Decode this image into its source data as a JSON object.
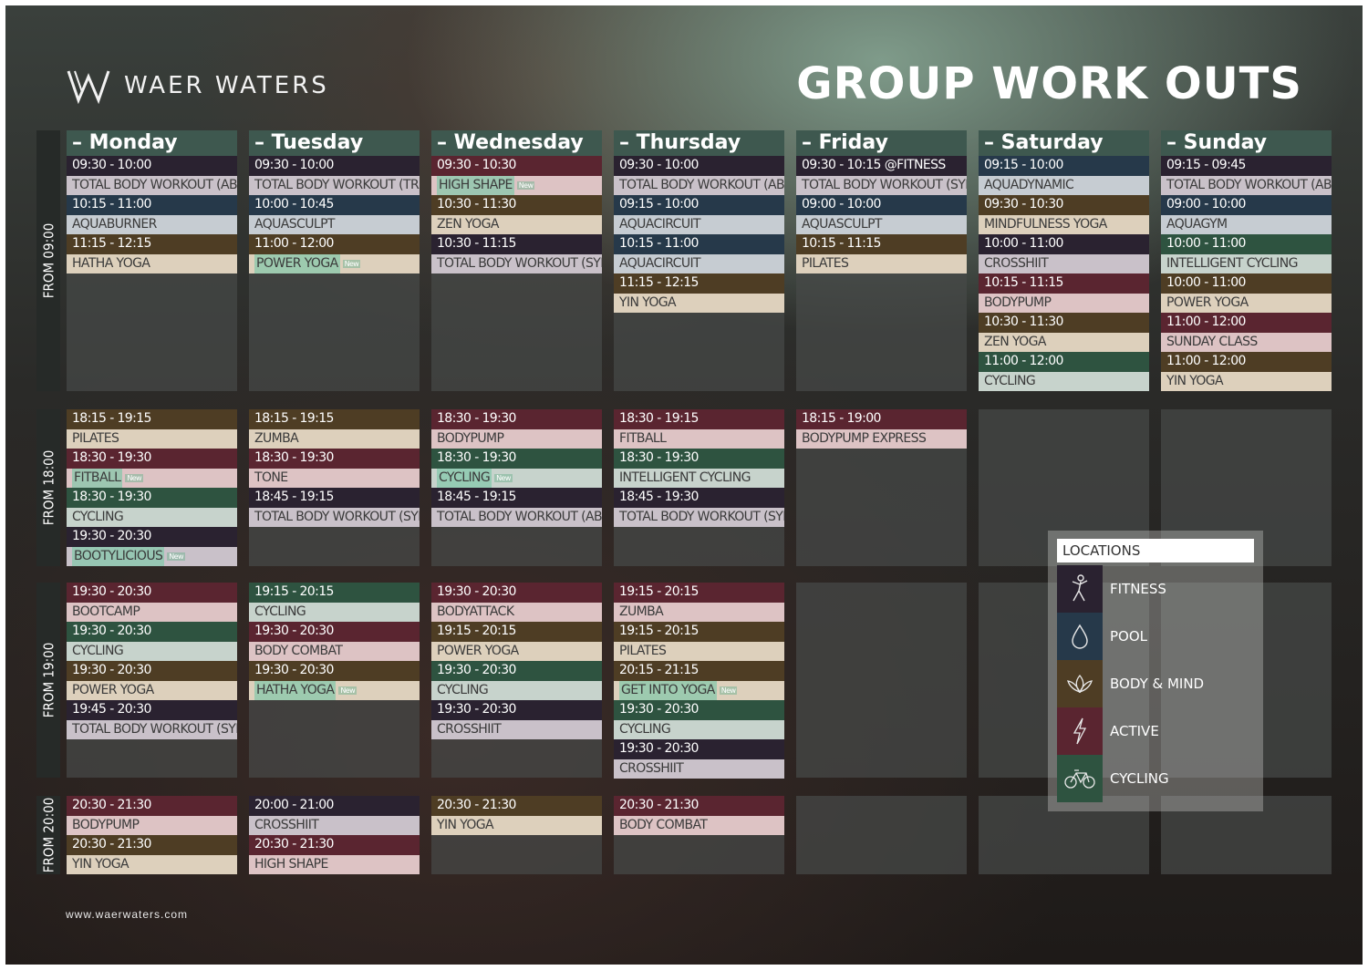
{
  "brand": {
    "name": "WAER WATERS",
    "website": "www.waerwaters.com"
  },
  "title": "GROUP WORK OUTS",
  "colors": {
    "fitness": "#2a2230",
    "pool": "#26394a",
    "body_mind": "#4e3d24",
    "active": "#5a2530",
    "cycling": "#2e5340",
    "header": "#3e584f"
  },
  "days": [
    "– Monday",
    "– Tuesday",
    "– Wednesday",
    "– Thursday",
    "– Friday",
    "– Saturday",
    "– Sunday"
  ],
  "slots": [
    "FROM 09:00",
    "FROM 18:00",
    "FROM 19:00",
    "FROM 20:00"
  ],
  "new_badge": "New",
  "legend": {
    "title": "LOCATIONS",
    "items": [
      {
        "label": "FITNESS",
        "icon": "fitness-icon",
        "type": "fitness"
      },
      {
        "label": "POOL",
        "icon": "pool-icon",
        "type": "pool"
      },
      {
        "label": "BODY & MIND",
        "icon": "lotus-icon",
        "type": "body_mind"
      },
      {
        "label": "ACTIVE",
        "icon": "lightning-icon",
        "type": "active"
      },
      {
        "label": "CYCLING",
        "icon": "bicycle-icon",
        "type": "cycling"
      }
    ]
  },
  "schedule": [
    [
      [
        [
          "09:30 - 10:00",
          "TOTAL BODY WORKOUT (ABS&CORE)",
          "fitness",
          false
        ],
        [
          "10:15 - 11:00",
          "AQUABURNER",
          "pool",
          false
        ],
        [
          "11:15 - 12:15",
          "HATHA YOGA",
          "body_mind",
          false
        ]
      ],
      [
        [
          "18:15 - 19:15",
          "PILATES",
          "body_mind",
          false
        ],
        [
          "18:30 - 19:30",
          "FITBALL",
          "active",
          true
        ],
        [
          "18:30 - 19:30",
          "CYCLING",
          "cycling",
          false
        ],
        [
          "19:30 - 20:30",
          "BOOTYLICIOUS",
          "fitness",
          true
        ]
      ],
      [
        [
          "19:30 - 20:30",
          "BOOTCAMP",
          "active",
          false
        ],
        [
          "19:30 - 20:30",
          "CYCLING",
          "cycling",
          false
        ],
        [
          "19:30 - 20:30",
          " POWER YOGA",
          "body_mind",
          false
        ],
        [
          "19:45 - 20:30",
          "TOTAL BODY WORKOUT (SYNRGY)",
          "fitness",
          false
        ]
      ],
      [
        [
          "20:30 - 21:30",
          "BODYPUMP",
          "active",
          false
        ],
        [
          "20:30 - 21:30",
          "YIN YOGA",
          "body_mind",
          false
        ]
      ]
    ],
    [
      [
        [
          "09:30 - 10:00",
          "TOTAL BODY WORKOUT (TRX)",
          "fitness",
          false
        ],
        [
          "10:00 - 10:45",
          "AQUASCULPT",
          "pool",
          false
        ],
        [
          "11:00 - 12:00",
          "POWER YOGA",
          "body_mind",
          true
        ]
      ],
      [
        [
          "18:15 - 19:15",
          "ZUMBA",
          "body_mind",
          false
        ],
        [
          "18:30 - 19:30",
          "TONE",
          "active",
          false
        ],
        [
          "18:45 - 19:15",
          "TOTAL BODY WORKOUT (SYNRGY)",
          "fitness",
          false
        ]
      ],
      [
        [
          "19:15 - 20:15",
          "CYCLING",
          "cycling",
          false
        ],
        [
          "19:30 - 20:30",
          "BODY COMBAT",
          "active",
          false
        ],
        [
          "19:30 - 20:30",
          "HATHA YOGA",
          "body_mind",
          true
        ]
      ],
      [
        [
          "20:00 - 21:00",
          "CROSSHIIT",
          "fitness",
          false
        ],
        [
          "20:30 - 21:30",
          "HIGH SHAPE",
          "active",
          false
        ]
      ]
    ],
    [
      [
        [
          "09:30 - 10:30",
          "HIGH SHAPE",
          "active",
          true
        ],
        [
          "10:30 - 11:30",
          "ZEN YOGA",
          "body_mind",
          false
        ],
        [
          "10:30 - 11:15",
          "TOTAL BODY WORKOUT (SYNRGY)",
          "fitness",
          false
        ]
      ],
      [
        [
          "18:30 - 19:30",
          "BODYPUMP",
          "active",
          false
        ],
        [
          "18:30 - 19:30",
          "CYCLING",
          "cycling",
          true
        ],
        [
          "18:45 - 19:15",
          "TOTAL BODY WORKOUT (ABS&CORE)",
          "fitness",
          false
        ]
      ],
      [
        [
          "19:30 - 20:30",
          "BODYATTACK",
          "active",
          false
        ],
        [
          "19:15 - 20:15",
          "POWER YOGA",
          "body_mind",
          false
        ],
        [
          "19:30 - 20:30",
          "CYCLING",
          "cycling",
          false
        ],
        [
          "19:30 - 20:30",
          "CROSSHIIT",
          "fitness",
          false
        ]
      ],
      [
        [
          "20:30 - 21:30",
          "YIN YOGA",
          "body_mind",
          false
        ]
      ]
    ],
    [
      [
        [
          "09:30 - 10:00",
          "TOTAL BODY WORKOUT (ABS&CORE)",
          "fitness",
          false
        ],
        [
          "09:15 - 10:00",
          "AQUACIRCUIT",
          "pool",
          false
        ],
        [
          "10:15 - 11:00",
          "AQUACIRCUIT",
          "pool",
          false
        ],
        [
          "11:15 - 12:15",
          "YIN YOGA",
          "body_mind",
          false
        ]
      ],
      [
        [
          "18:30 - 19:15",
          "FITBALL",
          "active",
          false
        ],
        [
          "18:30 - 19:30",
          "INTELLIGENT CYCLING",
          "cycling",
          false
        ],
        [
          "18:45 - 19:30",
          "TOTAL BODY WORKOUT (SYNRGY)",
          "fitness",
          false
        ]
      ],
      [
        [
          "19:15 - 20:15",
          "ZUMBA",
          "active",
          false
        ],
        [
          "19:15 - 20:15",
          "PILATES",
          "body_mind",
          false
        ],
        [
          "20:15 - 21:15",
          "GET INTO YOGA",
          "body_mind",
          true
        ],
        [
          "19:30 - 20:30",
          "CYCLING",
          "cycling",
          false
        ],
        [
          "19:30 - 20:30",
          "CROSSHIIT",
          "fitness",
          false
        ]
      ],
      [
        [
          "20:30 - 21:30",
          "BODY COMBAT",
          "active",
          false
        ]
      ]
    ],
    [
      [
        [
          "09:30 - 10:15 @FITNESS",
          "TOTAL BODY WORKOUT (SYNRGY)",
          "fitness",
          false
        ],
        [
          "09:00 - 10:00",
          "AQUASCULPT",
          "pool",
          false
        ],
        [
          "10:15 - 11:15",
          "PILATES",
          "body_mind",
          false
        ]
      ],
      [
        [
          "18:15 - 19:00",
          "BODYPUMP EXPRESS",
          "active",
          false
        ]
      ],
      [],
      []
    ],
    [
      [
        [
          "09:15 - 10:00",
          "AQUADYNAMIC",
          "pool",
          false
        ],
        [
          "09:30 - 10:30",
          "MINDFULNESS YOGA",
          "body_mind",
          false
        ],
        [
          "10:00 - 11:00",
          "CROSSHIIT",
          "fitness",
          false
        ],
        [
          "10:15 - 11:15",
          "BODYPUMP",
          "active",
          false
        ],
        [
          "10:30 - 11:30",
          "ZEN YOGA",
          "body_mind",
          false
        ],
        [
          "11:00 - 12:00",
          "CYCLING",
          "cycling",
          false
        ]
      ],
      [],
      [],
      []
    ],
    [
      [
        [
          "09:15 - 09:45",
          "TOTAL BODY WORKOUT (ABS&CORE)",
          "fitness",
          false
        ],
        [
          "09:00 - 10:00",
          "AQUAGYM",
          "pool",
          false
        ],
        [
          "10:00 - 11:00",
          "INTELLIGENT CYCLING",
          "cycling",
          false
        ],
        [
          "10:00 - 11:00",
          "POWER YOGA",
          "body_mind",
          false
        ],
        [
          "11:00 - 12:00",
          "SUNDAY CLASS",
          "active",
          false
        ],
        [
          "11:00 - 12:00",
          "YIN YOGA",
          "body_mind",
          false
        ]
      ],
      [],
      [],
      []
    ]
  ]
}
